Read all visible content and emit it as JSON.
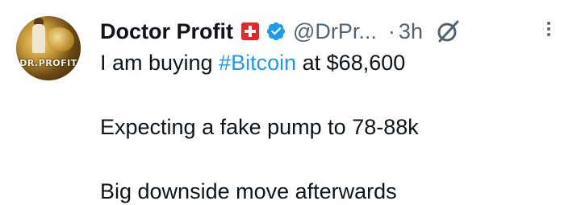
{
  "author": {
    "display_name": "Doctor Profit",
    "flag": "switzerland-flag-icon",
    "verified_icon": "verified-badge-icon",
    "handle": "@DrPr...",
    "avatar_logo_text": "DR.PROFIT"
  },
  "meta": {
    "separator": "·",
    "time": "3h",
    "grok_icon": "grok-icon",
    "more_icon": "more-options-icon"
  },
  "tweet": {
    "line1_before": "I am buying ",
    "line1_hashtag": "#Bitcoin",
    "line1_after": " at $68,600",
    "line2": "Expecting a fake pump to 78-88k",
    "line3": "Big downside move afterwards"
  },
  "colors": {
    "link": "#1d9bf0",
    "text": "#0f1419",
    "secondary": "#536471",
    "flag_red": "#e5262b"
  }
}
